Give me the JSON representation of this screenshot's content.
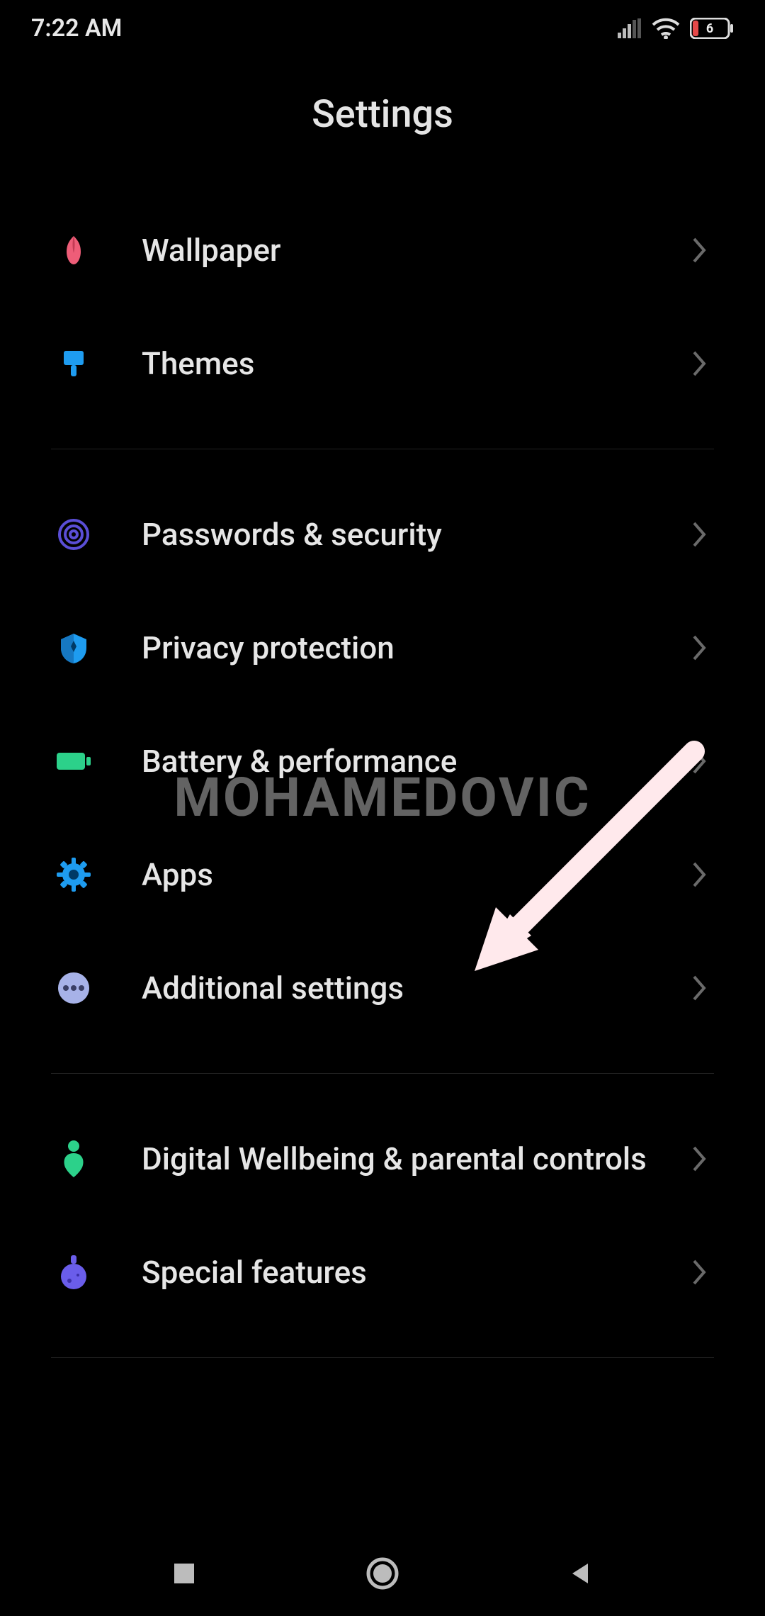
{
  "status": {
    "time": "7:22 AM",
    "battery_percent": "6"
  },
  "title": "Settings",
  "watermark": "MOHAMEDOVIC",
  "groups": [
    {
      "items": [
        {
          "id": "wallpaper",
          "label": "Wallpaper",
          "icon": "tulip",
          "color": "#ee5d78"
        },
        {
          "id": "themes",
          "label": "Themes",
          "icon": "brush",
          "color": "#1e9cf0"
        }
      ]
    },
    {
      "items": [
        {
          "id": "passwords-security",
          "label": "Passwords & security",
          "icon": "fingerprint",
          "color": "#5a4ed6"
        },
        {
          "id": "privacy-protection",
          "label": "Privacy protection",
          "icon": "shield",
          "color": "#1e9cf0"
        },
        {
          "id": "battery-performance",
          "label": "Battery & performance",
          "icon": "battery",
          "color": "#2cd18a"
        },
        {
          "id": "apps",
          "label": "Apps",
          "icon": "gear",
          "color": "#1e9cf0"
        },
        {
          "id": "additional-settings",
          "label": "Additional settings",
          "icon": "dots",
          "color": "#a7b2e8"
        }
      ]
    },
    {
      "items": [
        {
          "id": "digital-wellbeing",
          "label": "Digital Wellbeing & parental controls",
          "icon": "person-heart",
          "color": "#2cd18a"
        },
        {
          "id": "special-features",
          "label": "Special features",
          "icon": "flask",
          "color": "#6a5dea"
        }
      ]
    }
  ],
  "annotation": {
    "arrow_target": "additional-settings"
  }
}
